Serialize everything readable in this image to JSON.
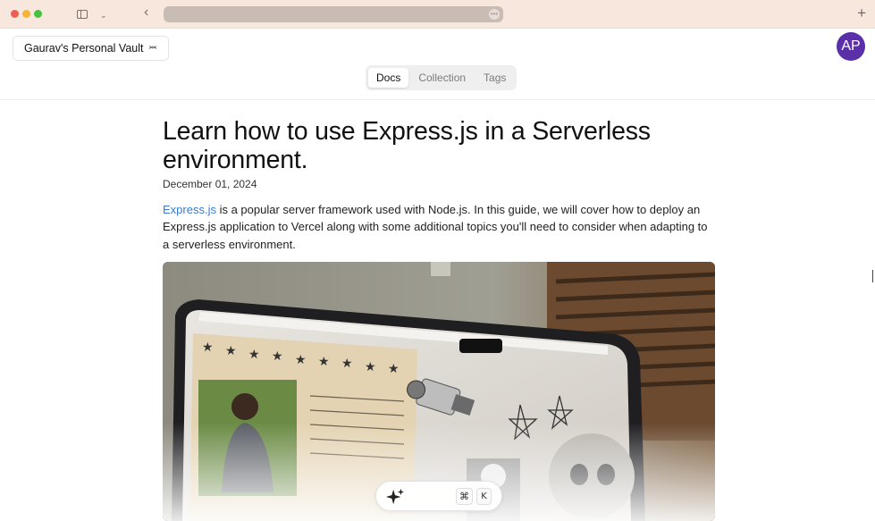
{
  "browser": {
    "url_placeholder": "",
    "icons": [
      "sidebar-toggle-icon",
      "chevron-down-icon",
      "back-arrow-icon",
      "more-icon",
      "plus-icon"
    ]
  },
  "header": {
    "vault_name": "Gaurav's Personal Vault",
    "avatar_initials": "AP",
    "avatar_color": "#5b2fa8"
  },
  "tabs": [
    {
      "label": "Docs",
      "active": true
    },
    {
      "label": "Collection",
      "active": false
    },
    {
      "label": "Tags",
      "active": false
    }
  ],
  "article": {
    "title": "Learn how to use Express.js in a Serverless environment.",
    "date": "December 01, 2024",
    "intro_link": "Express.js",
    "intro_text": " is a popular server framework used with Node.js. In this guide, we will cover how to deploy an Express.js application to Vercel along with some additional topics you'll need to consider when adapting to a serverless environment.",
    "link_color": "#3a7bd5"
  },
  "command_bar": {
    "icon": "sparkle-icon",
    "shortcut_modifier": "⌘",
    "shortcut_key": "K"
  }
}
